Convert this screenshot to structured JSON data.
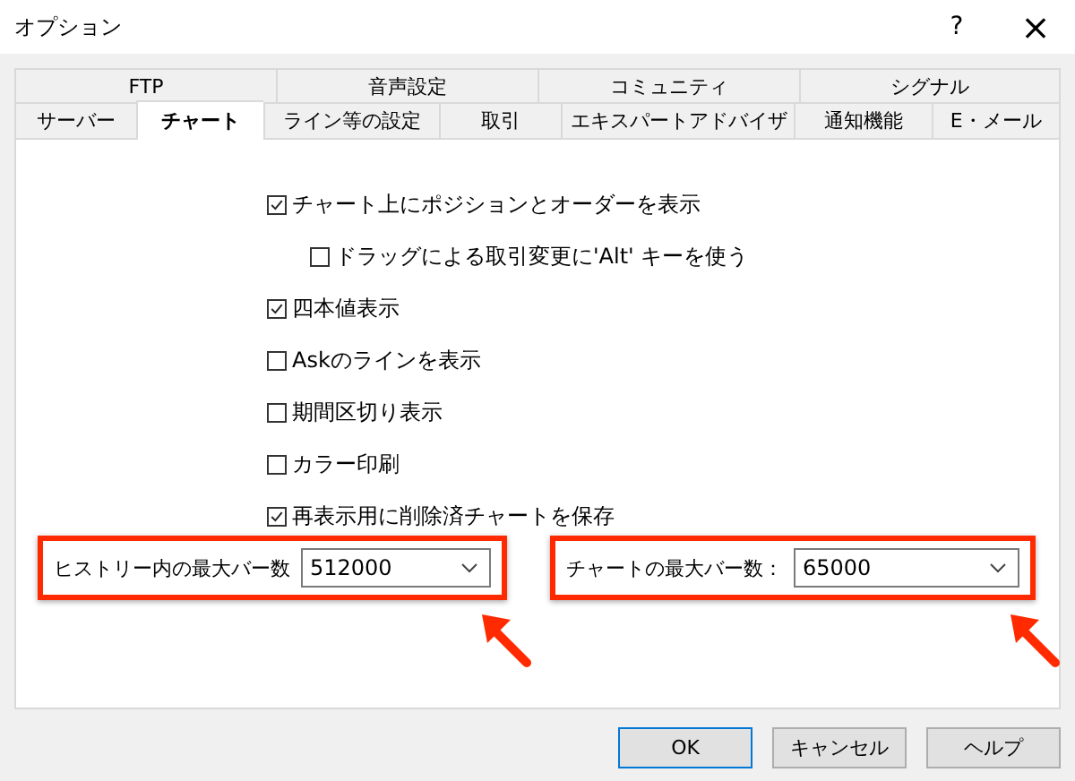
{
  "window": {
    "title": "オプション",
    "help": "?",
    "close": "×"
  },
  "tab_rows": [
    [
      {
        "label": "FTP",
        "selected": false
      },
      {
        "label": "音声設定",
        "selected": false
      },
      {
        "label": "コミュニティ",
        "selected": false
      },
      {
        "label": "シグナル",
        "selected": false
      }
    ],
    [
      {
        "label": "サーバー",
        "selected": false
      },
      {
        "label": "チャート",
        "selected": true
      },
      {
        "label": "ライン等の設定",
        "selected": false
      },
      {
        "label": "取引",
        "selected": false
      },
      {
        "label": "エキスパートアドバイザ",
        "selected": false
      },
      {
        "label": "通知機能",
        "selected": false
      },
      {
        "label": "E・メール",
        "selected": false
      }
    ]
  ],
  "options": [
    {
      "label": "チャート上にポジションとオーダーを表示",
      "checked": true,
      "children": [
        {
          "label": "ドラッグによる取引変更に'Alt' キーを使う",
          "checked": false
        }
      ]
    },
    {
      "label": "四本値表示",
      "checked": true
    },
    {
      "label": "Askのラインを表示",
      "checked": false
    },
    {
      "label": "期間区切り表示",
      "checked": false
    },
    {
      "label": "カラー印刷",
      "checked": false
    },
    {
      "label": "再表示用に削除済チャートを保存",
      "checked": true
    }
  ],
  "combos": [
    {
      "label": "ヒストリー内の最大バー数",
      "value": "512000",
      "highlighted": true
    },
    {
      "label": "チャートの最大バー数：",
      "value": "65000",
      "highlighted": true
    }
  ],
  "buttons": [
    {
      "label": "OK",
      "selected": true
    },
    {
      "label": "キャンセル",
      "selected": false
    },
    {
      "label": "ヘルプ",
      "selected": false
    }
  ]
}
